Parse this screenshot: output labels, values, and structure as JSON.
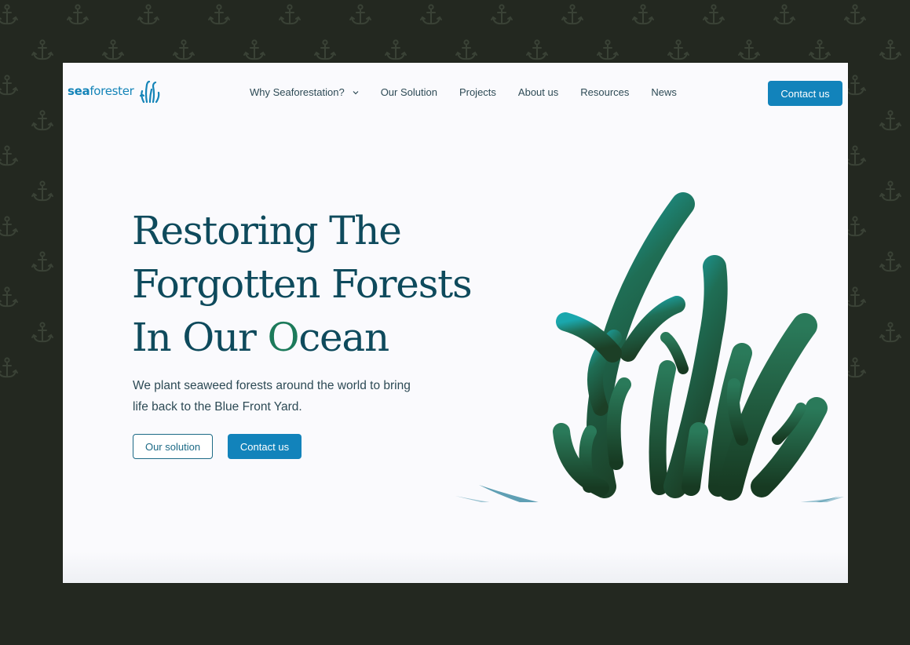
{
  "colors": {
    "outer_background": "#232820",
    "anchor_pattern": "#3a4236",
    "page_background": "#fafafd",
    "brand_blue": "#1283bb",
    "heading": "#0e4a5c",
    "body_text": "#2d4a55",
    "seaweed_teal": "#1aa7ad",
    "seaweed_dark": "#1c4a2a",
    "water": "#7fb3c4"
  },
  "logo": {
    "part1": "sea",
    "part2": "forester",
    "icon": "seaweed-logo-icon"
  },
  "nav": {
    "items": [
      {
        "label": "Why Seaforestation?",
        "has_dropdown": true
      },
      {
        "label": "Our Solution"
      },
      {
        "label": "Projects"
      },
      {
        "label": "About us"
      },
      {
        "label": "Resources"
      },
      {
        "label": "News"
      }
    ],
    "contact_label": "Contact us"
  },
  "hero": {
    "title_lines": [
      "Restoring The",
      "Forgotten Forests"
    ],
    "title_line3_before": "In Our ",
    "title_line3_highlight": "O",
    "title_line3_after": "cean",
    "subtitle": "We plant seaweed forests around the world to bring life back to the Blue Front Yard.",
    "primary_button": "Contact us",
    "secondary_button": "Our solution",
    "illustration": "seaweed-forest-illustration"
  },
  "background_icon": "anchor-icon"
}
